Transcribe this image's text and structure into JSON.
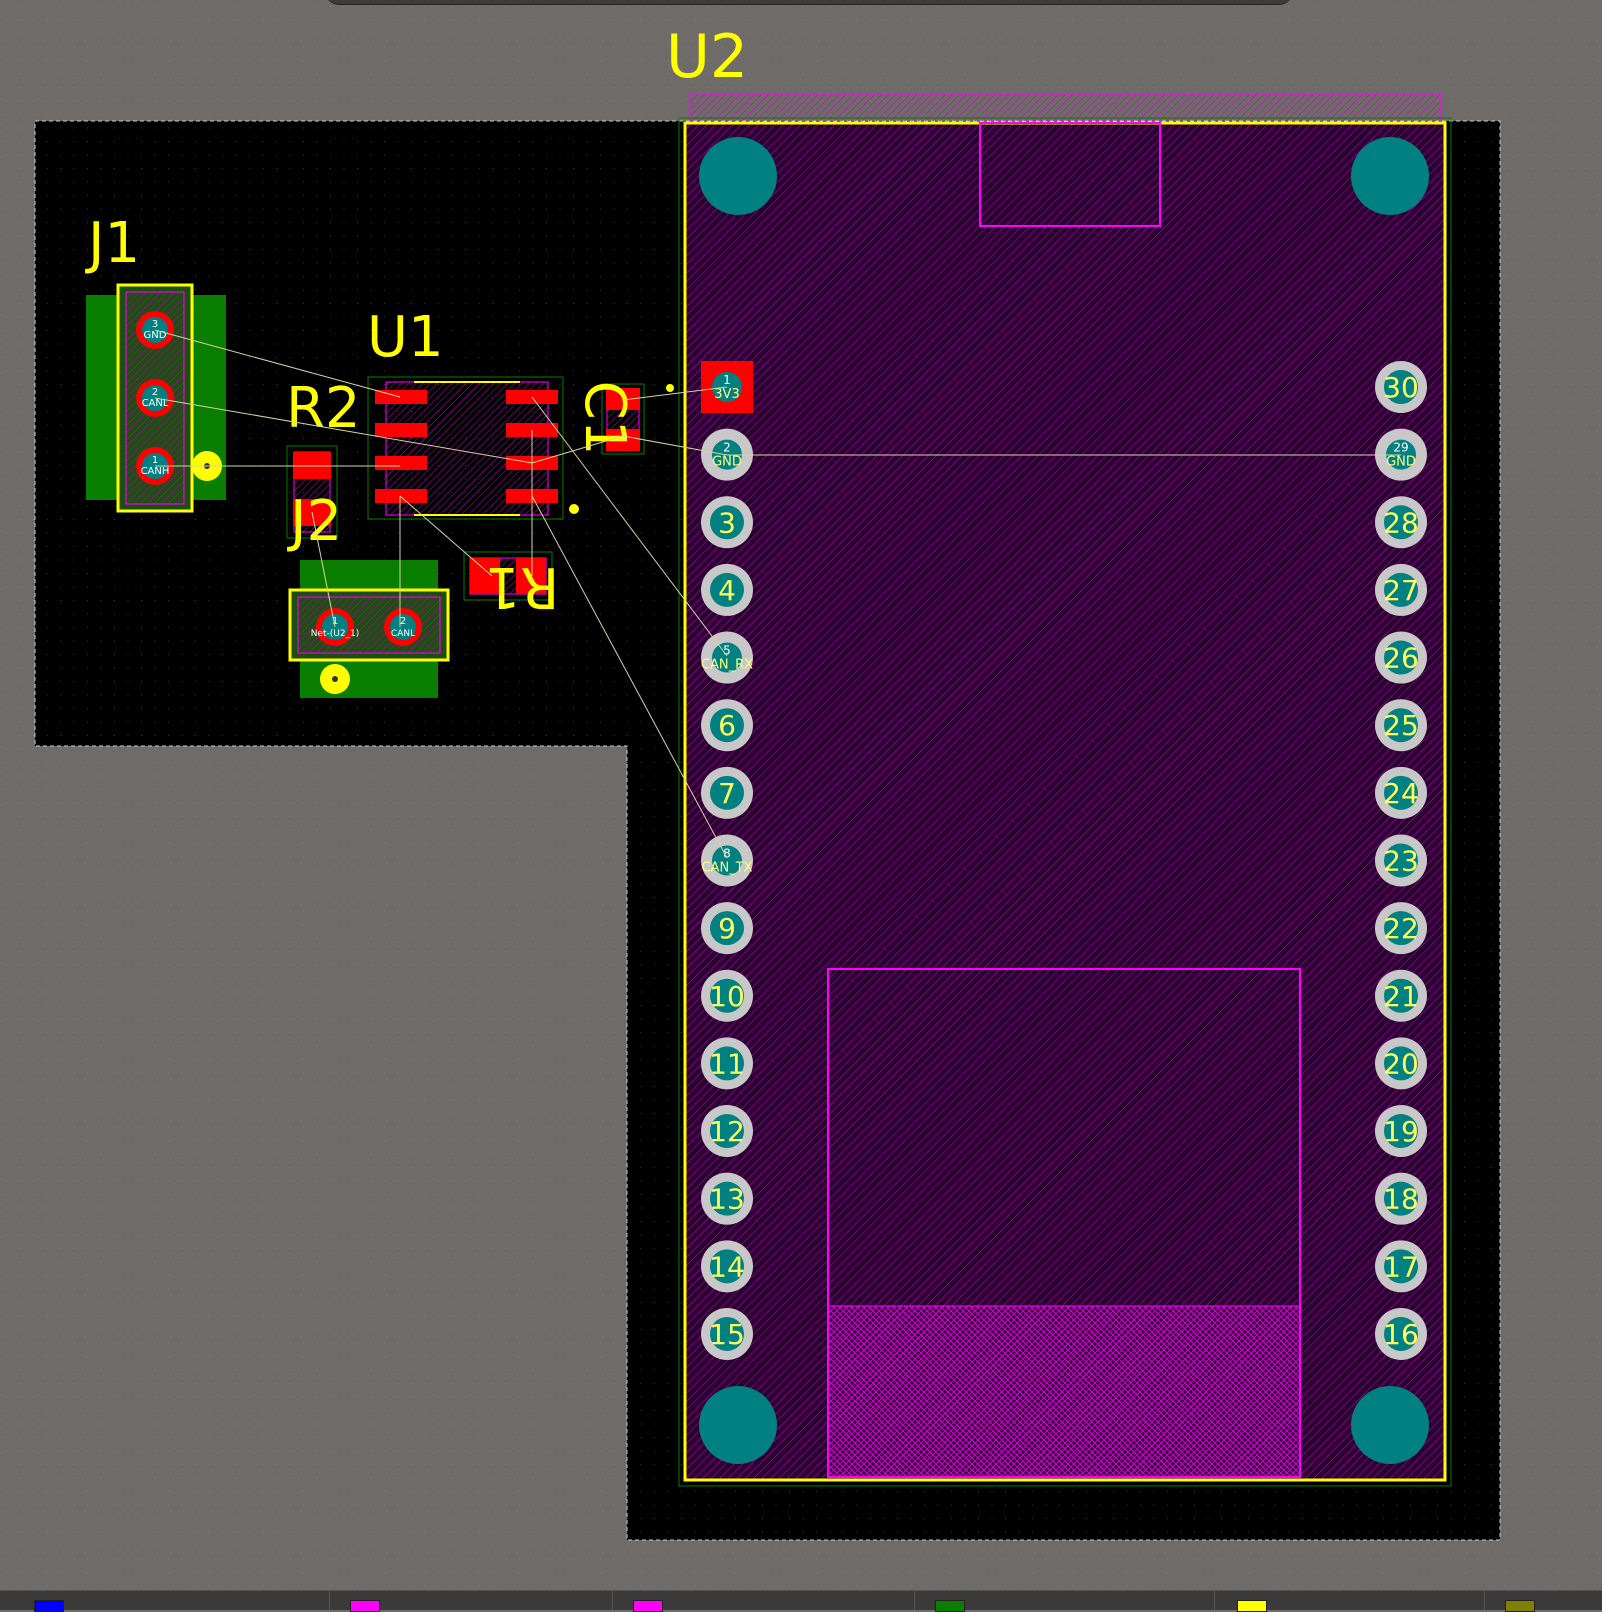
{
  "colors": {
    "background": "#6f6b68",
    "board": "#000000",
    "silkscreen": "#ffff00",
    "copper_top": "#ff0000",
    "copper_bottom": "#0a7e00",
    "courtyard": "#ff00ff",
    "pad": "#008080",
    "ratsnest": "#d4d4a0"
  },
  "designators": {
    "u2": "U2",
    "j1": "J1",
    "u1": "U1",
    "r2": "R2",
    "c1": "C1",
    "j2": "J2",
    "r1": "R1"
  },
  "j1_pads": [
    {
      "num": "3",
      "net": "GND"
    },
    {
      "num": "2",
      "net": "CANL"
    },
    {
      "num": "1",
      "net": "CANH"
    }
  ],
  "j2_pads": [
    {
      "num": "1",
      "net": "Net-(U2_1)"
    },
    {
      "num": "2",
      "net": "CANL"
    }
  ],
  "u2_left_pins": [
    {
      "num": "1",
      "net": "3V3"
    },
    {
      "num": "2",
      "net": "GND"
    },
    {
      "num": "3",
      "net": ""
    },
    {
      "num": "4",
      "net": ""
    },
    {
      "num": "5",
      "net": "CAN_RX"
    },
    {
      "num": "6",
      "net": ""
    },
    {
      "num": "7",
      "net": ""
    },
    {
      "num": "8",
      "net": "CAN_TX"
    },
    {
      "num": "9",
      "net": ""
    },
    {
      "num": "10",
      "net": ""
    },
    {
      "num": "11",
      "net": ""
    },
    {
      "num": "12",
      "net": ""
    },
    {
      "num": "13",
      "net": ""
    },
    {
      "num": "14",
      "net": ""
    },
    {
      "num": "15",
      "net": ""
    }
  ],
  "u2_right_pins": [
    {
      "num": "30",
      "net": ""
    },
    {
      "num": "29",
      "net": "GND"
    },
    {
      "num": "28",
      "net": ""
    },
    {
      "num": "27",
      "net": ""
    },
    {
      "num": "26",
      "net": ""
    },
    {
      "num": "25",
      "net": ""
    },
    {
      "num": "24",
      "net": ""
    },
    {
      "num": "23",
      "net": ""
    },
    {
      "num": "22",
      "net": ""
    },
    {
      "num": "21",
      "net": ""
    },
    {
      "num": "20",
      "net": ""
    },
    {
      "num": "19",
      "net": ""
    },
    {
      "num": "18",
      "net": ""
    },
    {
      "num": "17",
      "net": ""
    },
    {
      "num": "16",
      "net": ""
    }
  ],
  "layer_tabs": [
    {
      "name": "layer-tab-1",
      "color": "#0000ff"
    },
    {
      "name": "layer-tab-2",
      "color": "#ff00ff"
    },
    {
      "name": "layer-tab-3",
      "color": "#ff00ff"
    },
    {
      "name": "layer-tab-4",
      "color": "#0a7e00"
    },
    {
      "name": "layer-tab-5",
      "color": "#ffff00"
    },
    {
      "name": "layer-tab-6",
      "color": "#808000"
    }
  ]
}
